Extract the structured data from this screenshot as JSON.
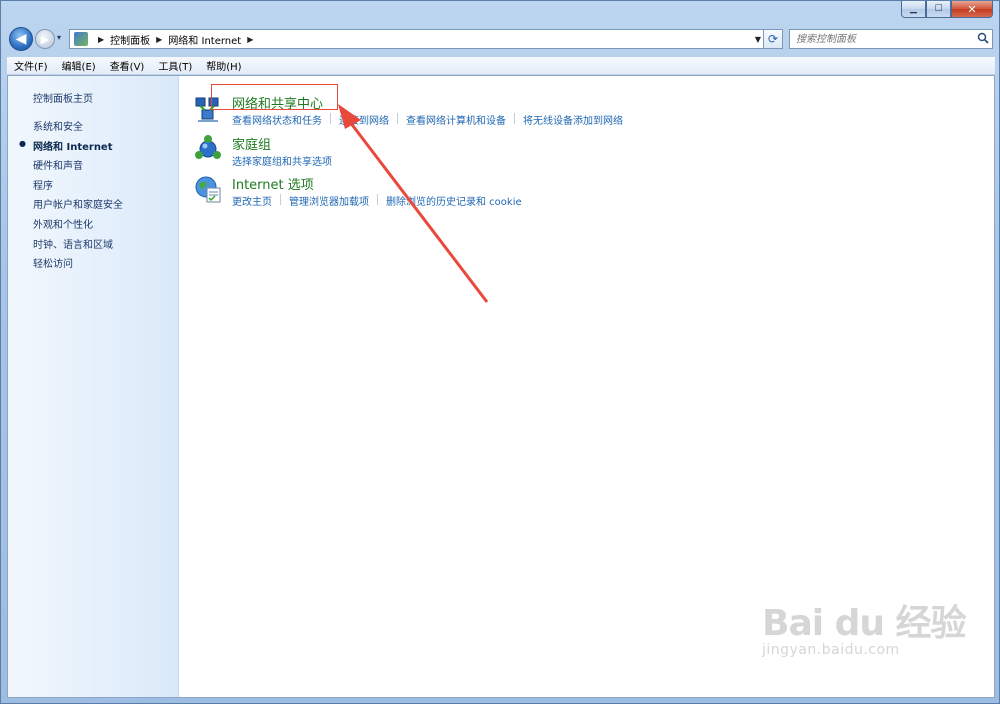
{
  "window": {
    "caption": {
      "minimize": "▁",
      "maximize": "☐",
      "close": "✕"
    }
  },
  "navbar": {
    "back_glyph": "◀",
    "forward_glyph": "▶",
    "history_glyph": "▾",
    "address": {
      "segments": [
        "控制面板",
        "网络和 Internet"
      ],
      "separator": "▶",
      "dropdown_glyph": "▼"
    },
    "refresh_glyph": "⟳",
    "search": {
      "placeholder": "搜索控制面板",
      "icon": "search-icon"
    }
  },
  "menubar": {
    "items": [
      "文件(F)",
      "编辑(E)",
      "查看(V)",
      "工具(T)",
      "帮助(H)"
    ]
  },
  "sidebar": {
    "items": [
      {
        "label": "控制面板主页",
        "current": false
      },
      {
        "label": "系统和安全",
        "current": false
      },
      {
        "label": "网络和 Internet",
        "current": true
      },
      {
        "label": "硬件和声音",
        "current": false
      },
      {
        "label": "程序",
        "current": false
      },
      {
        "label": "用户帐户和家庭安全",
        "current": false
      },
      {
        "label": "外观和个性化",
        "current": false
      },
      {
        "label": "时钟、语言和区域",
        "current": false
      },
      {
        "label": "轻松访问",
        "current": false
      }
    ],
    "bullet": "●"
  },
  "categories": [
    {
      "title": "网络和共享中心",
      "icon": "network-sharing-center-icon",
      "links": [
        "查看网络状态和任务",
        "连接到网络",
        "查看网络计算机和设备",
        "将无线设备添加到网络"
      ]
    },
    {
      "title": "家庭组",
      "icon": "homegroup-icon",
      "links": [
        "选择家庭组和共享选项"
      ]
    },
    {
      "title": "Internet 选项",
      "icon": "internet-options-icon",
      "links": [
        "更改主页",
        "管理浏览器加载项",
        "删除浏览的历史记录和 cookie"
      ]
    }
  ],
  "annotation": {
    "color": "#e8493b"
  },
  "watermark": {
    "logo": "Bai du 经验",
    "url": "jingyan.baidu.com"
  }
}
